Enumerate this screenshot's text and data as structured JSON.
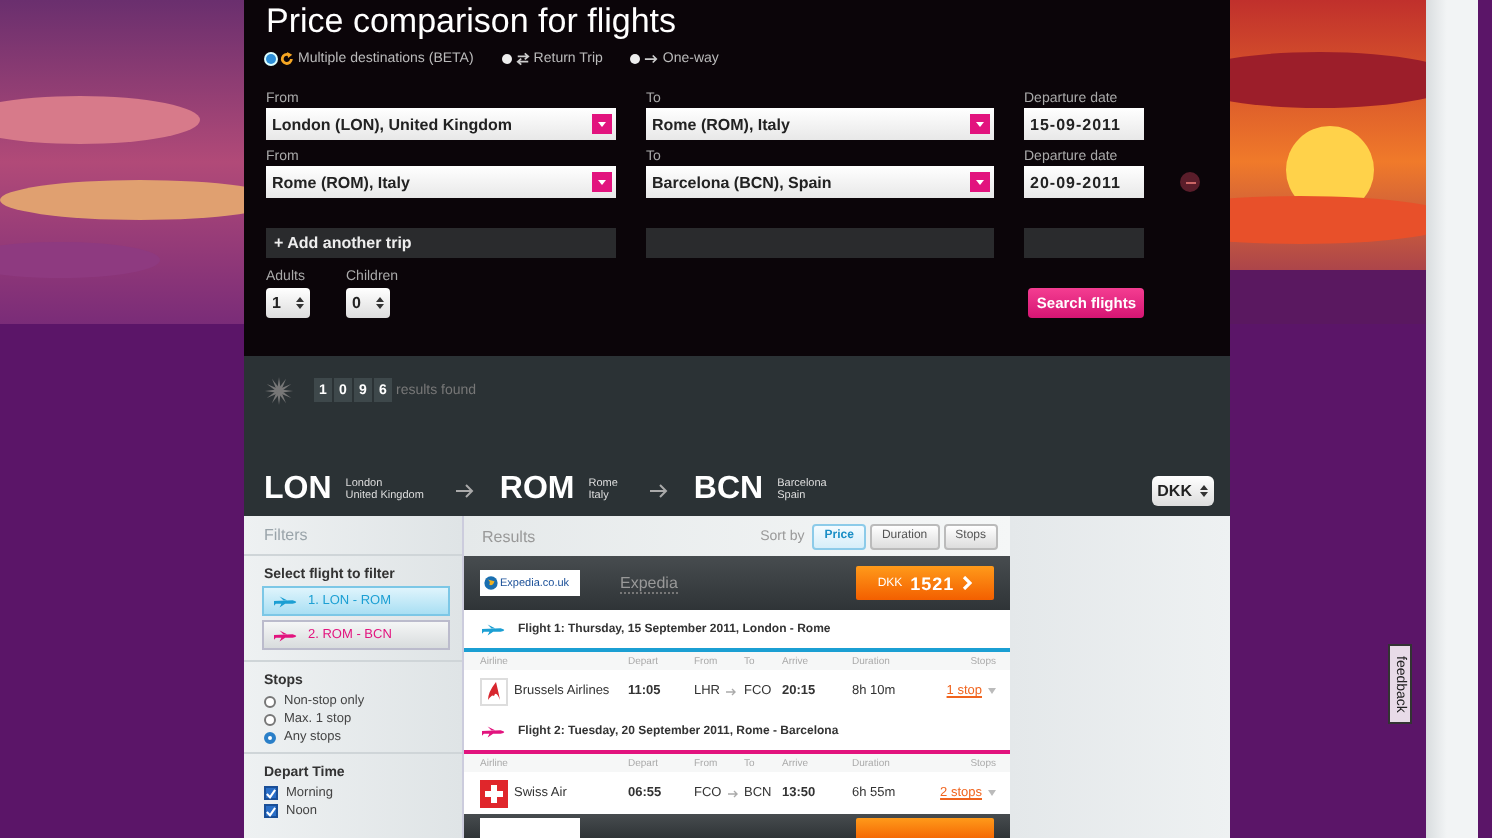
{
  "page_title": "Price comparison for flights",
  "trip_types": [
    {
      "label": "Multiple destinations (BETA)",
      "kind": "multi",
      "selected": true
    },
    {
      "label": "Return Trip",
      "kind": "return",
      "selected": false
    },
    {
      "label": "One-way",
      "kind": "oneway",
      "selected": false
    }
  ],
  "trips": [
    {
      "from_label": "From",
      "from": "London (LON), United Kingdom",
      "to_label": "To",
      "to": "Rome (ROM), Italy",
      "date_label": "Departure date",
      "date": "15-09-2011",
      "removable": false
    },
    {
      "from_label": "From",
      "from": "Rome (ROM), Italy",
      "to_label": "To",
      "to": "Barcelona (BCN), Spain",
      "date_label": "Departure date",
      "date": "20-09-2011",
      "removable": true
    }
  ],
  "add_trip": "+ Add another trip",
  "passengers": [
    {
      "label": "Adults",
      "value": "1"
    },
    {
      "label": "Children",
      "value": "0"
    }
  ],
  "search_button": "Search flights",
  "results_count": {
    "digits": [
      "1",
      "0",
      "9",
      "6"
    ],
    "label": "results found"
  },
  "route": [
    {
      "code": "LON",
      "city": "London",
      "country": "United Kingdom"
    },
    {
      "code": "ROM",
      "city": "Rome",
      "country": "Italy"
    },
    {
      "code": "BCN",
      "city": "Barcelona",
      "country": "Spain"
    }
  ],
  "currency": "DKK",
  "filters": {
    "title": "Filters",
    "select_title": "Select flight to filter",
    "flights": [
      {
        "label": "1. LON - ROM",
        "selected": true,
        "color": "#1b9fd3"
      },
      {
        "label": "2. ROM - BCN",
        "selected": false,
        "color": "#e2137e"
      }
    ],
    "stops_title": "Stops",
    "stops": [
      {
        "label": "Non-stop only",
        "selected": false
      },
      {
        "label": "Max. 1 stop",
        "selected": false
      },
      {
        "label": "Any stops",
        "selected": true
      }
    ],
    "depart_title": "Depart Time",
    "depart_times": [
      {
        "label": "Morning",
        "checked": true
      },
      {
        "label": "Noon",
        "checked": true
      }
    ]
  },
  "results": {
    "title": "Results",
    "sort_label": "Sort by",
    "sort_options": [
      {
        "label": "Price",
        "selected": true
      },
      {
        "label": "Duration",
        "selected": false
      },
      {
        "label": "Stops",
        "selected": false
      }
    ],
    "offers": [
      {
        "logo_text": "Expedia.co.uk",
        "provider": "Expedia",
        "currency": "DKK",
        "price": "1521",
        "legs": [
          {
            "title": "Flight 1: Thursday, 15 September 2011, London - Rome",
            "color": "#1b9fd3",
            "columns": [
              "Airline",
              "Depart",
              "From",
              "To",
              "Arrive",
              "Duration",
              "Stops"
            ],
            "kind": "swirl",
            "airline": "Brussels Airlines",
            "depart": "11:05",
            "from": "LHR",
            "to": "FCO",
            "arrive": "20:15",
            "duration": "8h 10m",
            "stops": "1 stop"
          },
          {
            "title": "Flight 2: Tuesday, 20 September 2011, Rome - Barcelona",
            "color": "#e2137e",
            "columns": [
              "Airline",
              "Depart",
              "From",
              "To",
              "Arrive",
              "Duration",
              "Stops"
            ],
            "kind": "cross",
            "airline": "Swiss Air",
            "depart": "06:55",
            "from": "FCO",
            "to": "BCN",
            "arrive": "13:50",
            "duration": "6h 55m",
            "stops": "2 stops"
          }
        ]
      }
    ],
    "more_offers": true
  },
  "feedback": "feedback"
}
